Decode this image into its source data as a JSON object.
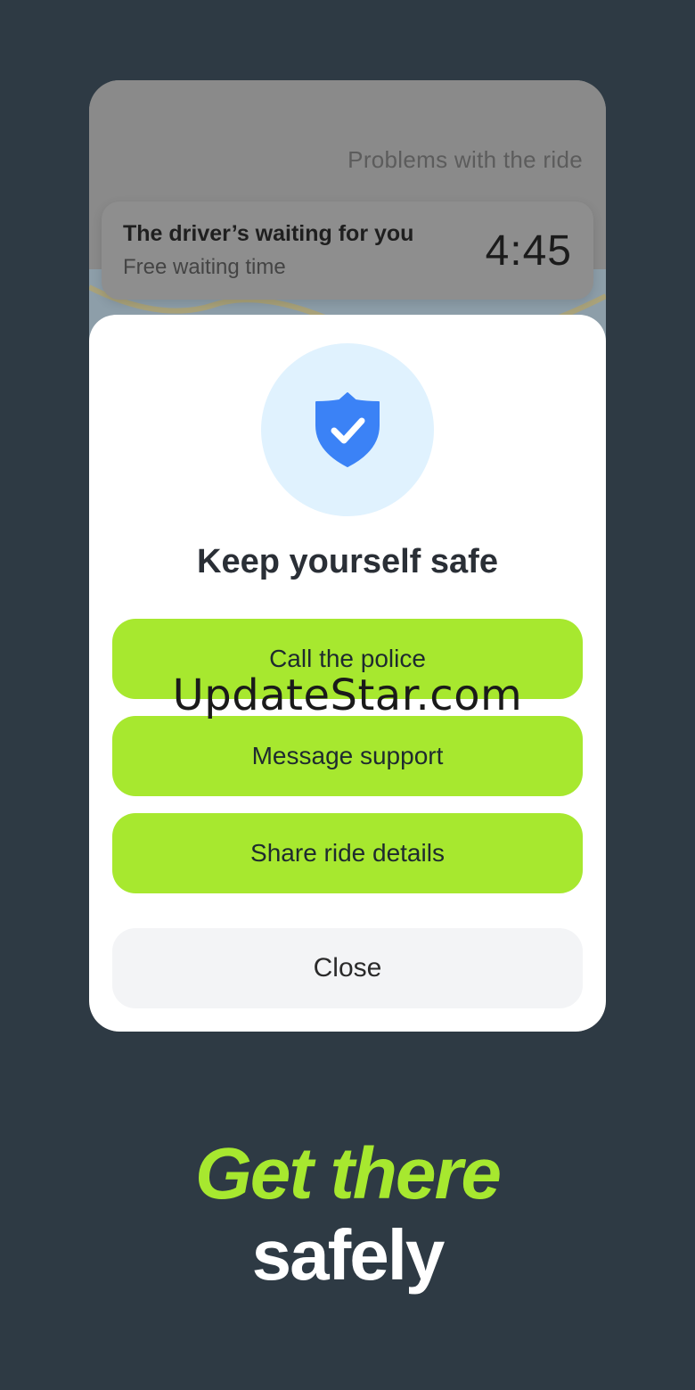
{
  "ride": {
    "problems_link": "Problems with the ride",
    "waiting_title": "The driver’s waiting for you",
    "waiting_subtitle": "Free waiting time",
    "timer": "4:45"
  },
  "safety_sheet": {
    "icon": "shield-check-icon",
    "title": "Keep yourself safe",
    "buttons": {
      "call_police": "Call the police",
      "message_support": "Message support",
      "share_ride": "Share ride details",
      "close": "Close"
    }
  },
  "watermark": "UpdateStar.com",
  "promo": {
    "line1": "Get there",
    "line2": "safely"
  },
  "colors": {
    "background": "#2e3a44",
    "accent": "#a7e82f",
    "shield": "#3b82f6",
    "shield_bg": "#e0f2fe"
  }
}
